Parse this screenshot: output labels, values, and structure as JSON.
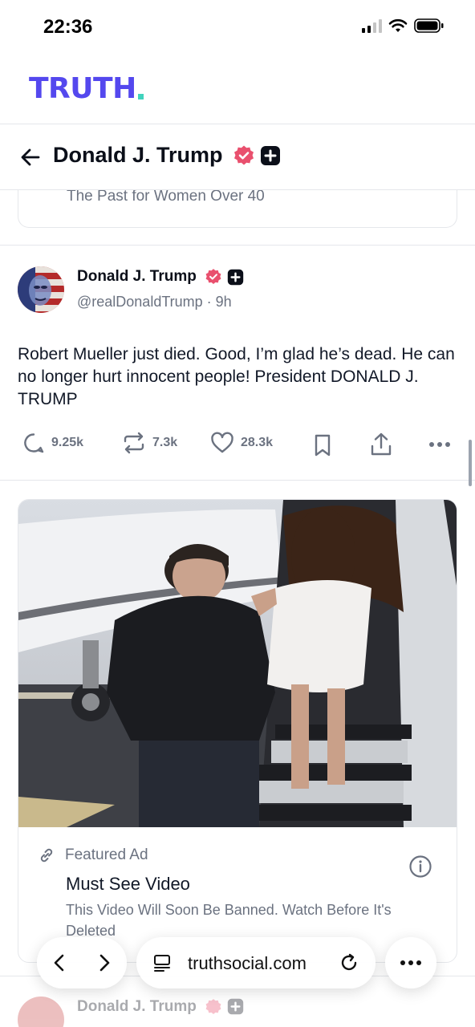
{
  "status_bar": {
    "time": "22:36"
  },
  "brand": {
    "name": "TRUTH"
  },
  "header": {
    "title": "Donald J. Trump"
  },
  "previous_ad": {
    "text": "The Past for Women Over 40"
  },
  "post": {
    "author_name": "Donald J. Trump",
    "handle_time": "@realDonaldTrump · 9h",
    "body": "Robert Mueller just died. Good, I’m glad he’s dead. He can no longer hurt innocent people! President DONALD J. TRUMP",
    "stats": {
      "replies": "9.25k",
      "retruths": "7.3k",
      "likes": "28.3k"
    }
  },
  "ad": {
    "label": "Featured Ad",
    "title": "Must See Video",
    "description": "This Video Will Soon Be Banned. Watch Before It's Deleted"
  },
  "next_post": {
    "author_name": "Donald J. Trump"
  },
  "browser": {
    "url": "truthsocial.com"
  },
  "colors": {
    "brand": "#5448ee",
    "brand_dot": "#41d3bd",
    "verified": "#e9506e"
  },
  "icons": [
    "back-arrow-icon",
    "verified-icon",
    "plus-badge-icon",
    "reply-icon",
    "retruth-icon",
    "like-icon",
    "bookmark-icon",
    "share-icon",
    "more-icon",
    "link-icon",
    "info-icon",
    "chevron-left-icon",
    "chevron-right-icon",
    "tabs-icon",
    "reload-icon"
  ]
}
